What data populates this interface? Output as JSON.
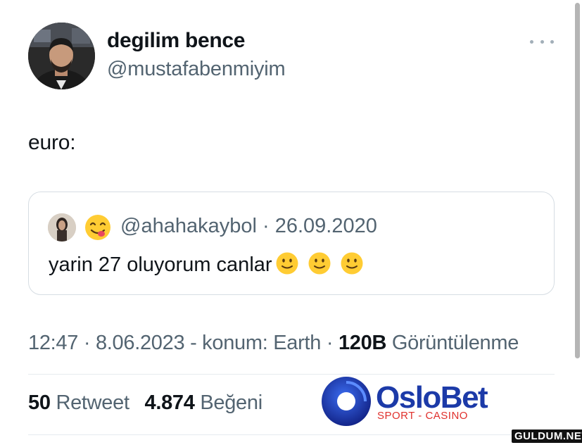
{
  "author": {
    "display_name": "degilim bence",
    "handle": "@mustafabenmiyim"
  },
  "tweet": {
    "text": "euro:"
  },
  "quoted_tweet": {
    "handle": "@ahahakaybol",
    "separator": "·",
    "date": "26.09.2020",
    "text": "yarin 27 oluyorum canlar",
    "name_emoji": "savoring-face",
    "trailing_emojis": [
      "slightly-smiling-face",
      "slightly-smiling-face",
      "slightly-smiling-face"
    ]
  },
  "meta": {
    "time": "12:47",
    "sep1": "·",
    "date": "8.06.2023",
    "location": "- konum: Earth",
    "sep2": "·",
    "views_count": "120B",
    "views_label": "Görüntülenme"
  },
  "stats": {
    "retweets_count": "50",
    "retweets_label": "Retweet",
    "likes_count": "4.874",
    "likes_label": "Beğeni"
  },
  "ad": {
    "brand": "OsloBet",
    "tagline": "SPORT - CASINO",
    "brand_color": "#1c3aa8",
    "tagline_color": "#e0302c"
  },
  "watermark": "GULDUM.NET",
  "colors": {
    "text": "#0f1419",
    "secondary": "#536471",
    "border": "#d6dde3",
    "emoji": "#ffcc33"
  }
}
